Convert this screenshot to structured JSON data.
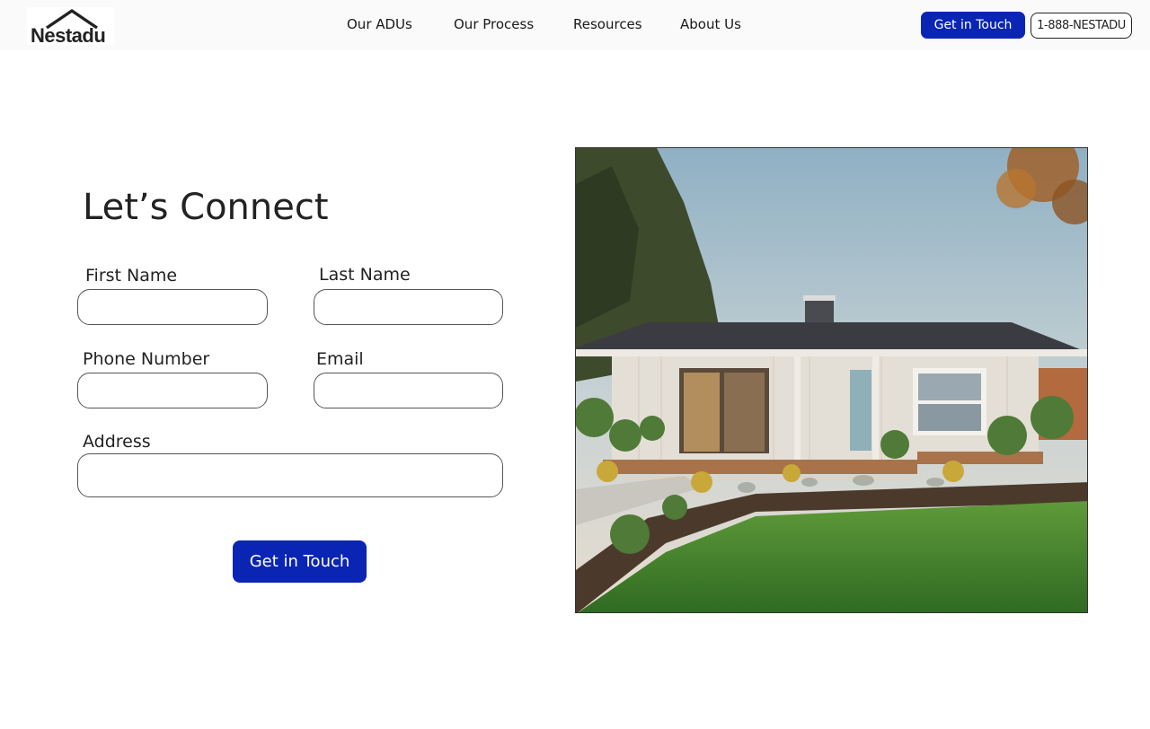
{
  "header": {
    "logo_text": "Nestadu",
    "nav": [
      "Our ADUs",
      "Our Process",
      "Resources",
      "About Us"
    ],
    "cta_label": "Get in Touch",
    "phone_label": "1-888-NESTADU"
  },
  "form": {
    "title": "Let’s Connect",
    "first_name_label": "First Name",
    "last_name_label": "Last Name",
    "phone_label": "Phone Number",
    "email_label": "Email",
    "address_label": "Address",
    "first_name_value": "",
    "last_name_value": "",
    "phone_value": "",
    "email_value": "",
    "address_value": "",
    "submit_label": "Get in Touch"
  },
  "colors": {
    "brand_blue": "#0a25b4",
    "header_bg": "#fafafa",
    "text": "#222222"
  },
  "icons": {
    "logo_mark": "house-roof-icon"
  }
}
